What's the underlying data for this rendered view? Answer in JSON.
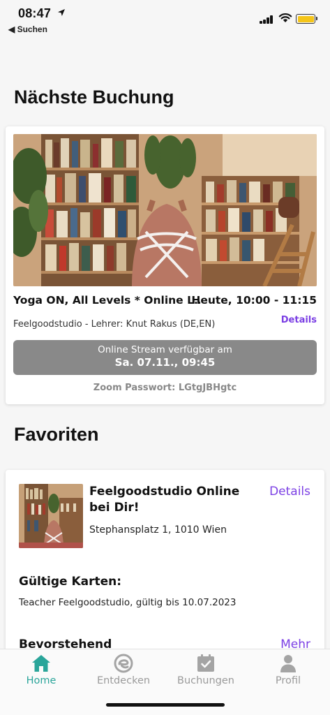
{
  "status_bar": {
    "time": "08:47",
    "back_app": "◀ Suchen"
  },
  "colors": {
    "accent_purple": "#7b3fe4",
    "active_tab": "#2aa59a",
    "inactive_tab": "#9a9a9a",
    "stream_button": "#898989",
    "battery": "#f5c518"
  },
  "next_booking": {
    "section_title": "Nächste Buchung",
    "class_title": "Yoga ON, All Levels * Online L...",
    "time": "Heute, 10:00 - 11:15",
    "studio_teacher": "Feelgoodstudio - Lehrer: Knut Rakus (DE,EN)",
    "details_label": "Details",
    "stream_line1": "Online Stream verfügbar am",
    "stream_line2": "Sa. 07.11., 09:45",
    "zoom_password": "Zoom Passwort: LGtgJBHgtc"
  },
  "favorites": {
    "section_title": "Favoriten",
    "studio_name": "Feelgoodstudio Online bei Dir!",
    "details_label": "Details",
    "address": "Stephansplatz 1, 1010 Wien",
    "valid_cards_title": "Gültige Karten:",
    "valid_card": "Teacher Feelgoodstudio, gültig bis 10.07.2023",
    "upcoming_title": "Bevorstehend",
    "more_label": "Mehr"
  },
  "tabbar": {
    "items": [
      {
        "label": "Home",
        "icon": "home-icon",
        "active": true
      },
      {
        "label": "Entdecken",
        "icon": "discover-icon",
        "active": false
      },
      {
        "label": "Buchungen",
        "icon": "calendar-check-icon",
        "active": false
      },
      {
        "label": "Profil",
        "icon": "person-icon",
        "active": false
      }
    ]
  }
}
